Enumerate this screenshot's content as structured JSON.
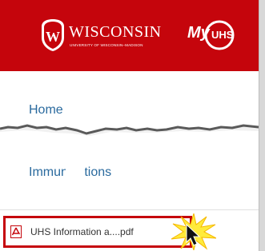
{
  "header": {
    "logo_word": "WISCONSIN",
    "logo_subtitle": "UNIVERSITY OF WISCONSIN–MADISON",
    "app_logo_prefix": "My",
    "app_logo_suffix": "UHS",
    "background_color": "#c5050c"
  },
  "nav": {
    "home_label": "Home",
    "immunizations_label": "Immunizations",
    "link_color": "#2a6a9e"
  },
  "file": {
    "name": "UHS Information a....pdf",
    "icon": "pdf-file-icon",
    "highlight_color": "#c5050c"
  },
  "annotation": {
    "pointer_icon": "mouse-pointer-icon",
    "burst_icon": "starburst-icon",
    "burst_color": "#ffeb3b"
  }
}
